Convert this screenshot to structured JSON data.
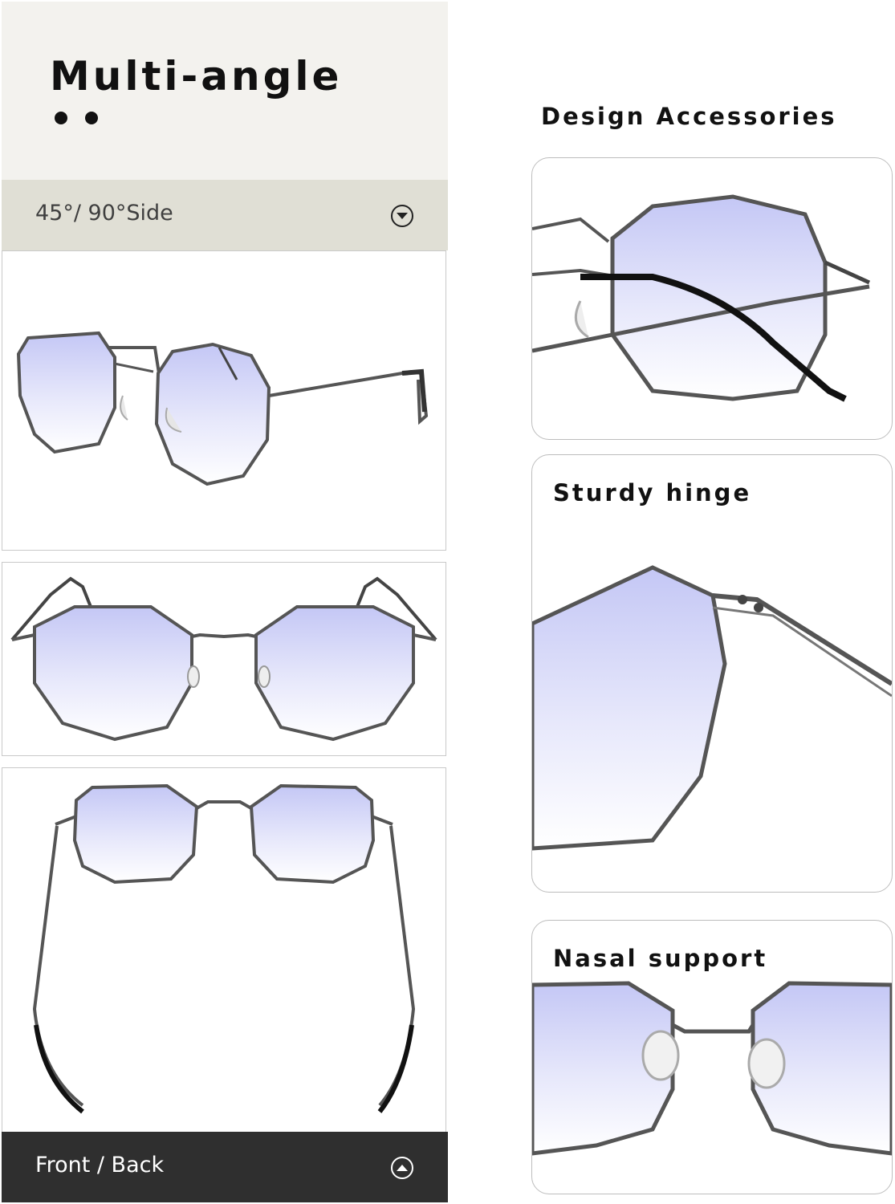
{
  "header": {
    "title": "Multi-angle",
    "dots": [
      "dot",
      "dot"
    ]
  },
  "angle_bar": {
    "label": "45°/ 90°Side",
    "icon": "chevron-down-circle-icon"
  },
  "front_back_bar": {
    "label": "Front / Back",
    "icon": "chevron-up-circle-icon"
  },
  "right_column": {
    "title": "Design Accessories",
    "cards": [
      {
        "title": ""
      },
      {
        "title": "Sturdy hinge"
      },
      {
        "title": "Nasal support"
      }
    ]
  },
  "colors": {
    "header_bg": "#f3f2ee",
    "angle_bar_bg": "#e0dfd5",
    "front_back_bg": "#2f2f2f",
    "frame_metal": "#555555",
    "lens_tint": "#c9cdf6"
  }
}
